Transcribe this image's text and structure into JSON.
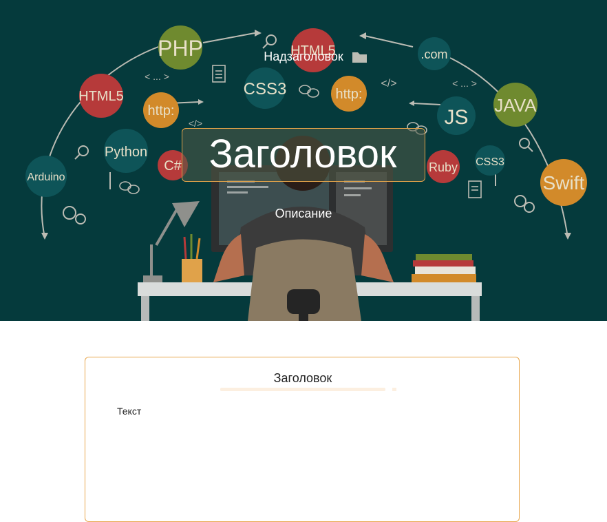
{
  "hero": {
    "pre_title": "Надзаголовок",
    "title": "Заголовок",
    "description": "Описание",
    "tech_labels": {
      "php": "PHP",
      "html5_top": "HTML5",
      "html5_left": "HTML5",
      "css3_center": "CSS3",
      "http_center": "http:",
      "http_left": "http:",
      "python": "Python",
      "csharp": "C#",
      "arduino": "Arduino",
      "dotcom": ".com",
      "java": "JAVA",
      "js": "JS",
      "ruby": "Ruby",
      "css3_right": "CSS3",
      "swift": "Swift"
    },
    "code_tags": {
      "tag1": "< ... >",
      "tag2": "</>",
      "tag3": "</>",
      "tag4": "< ... >"
    },
    "colors": {
      "background": "#053a3c",
      "accent": "#e0a24a"
    }
  },
  "card": {
    "title": "Заголовок",
    "text": "Текст",
    "border_color": "#e8a54a"
  }
}
